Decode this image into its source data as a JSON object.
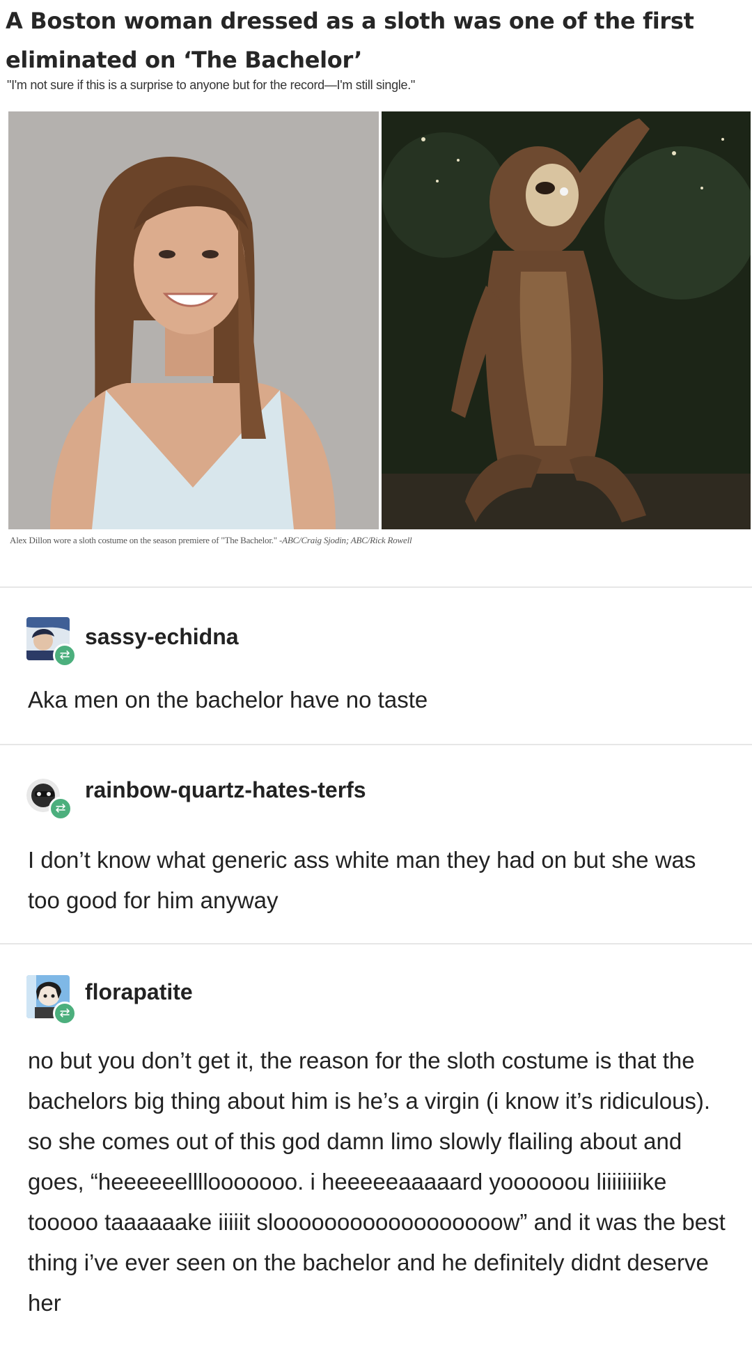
{
  "article": {
    "headline": "A Boston woman dressed as a sloth was one of the first eliminated on ‘The Bachelor’",
    "quote": "\"I'm not sure if this is a surprise to anyone but for the record—I'm still single.\"",
    "caption_text": "Alex Dillon wore a sloth costume on the season premiere of \"The Bachelor.\" -",
    "caption_credit": "ABC/Craig Sjodin; ABC/Rick Rowell"
  },
  "posts": [
    {
      "username": "sassy-echidna",
      "body": "Aka men on the bachelor have no taste"
    },
    {
      "username": "rainbow-quartz-hates-terfs",
      "body": "I don’t know what generic ass white man they had on but she was too good for him anyway"
    },
    {
      "username": "florapatite",
      "body": "no but you don’t get it, the reason for the sloth costume is that the bachelors big thing about him is he’s a virgin (i know it’s ridiculous). so she comes out of this god damn limo slowly flailing about and goes, “heeeeeellllooooooo. i heeeeeaaaaard yoooooou liiiiiiiike tooooo taaaaaake iiiiit sloooooooooooooooooow” and it was the best thing i’ve ever seen on the bachelor and he definitely didnt deserve her"
    }
  ],
  "icons": {
    "reblog": "reblog-icon"
  },
  "colors": {
    "reblog_badge": "#4caf7d",
    "divider": "#e6e6e6"
  }
}
